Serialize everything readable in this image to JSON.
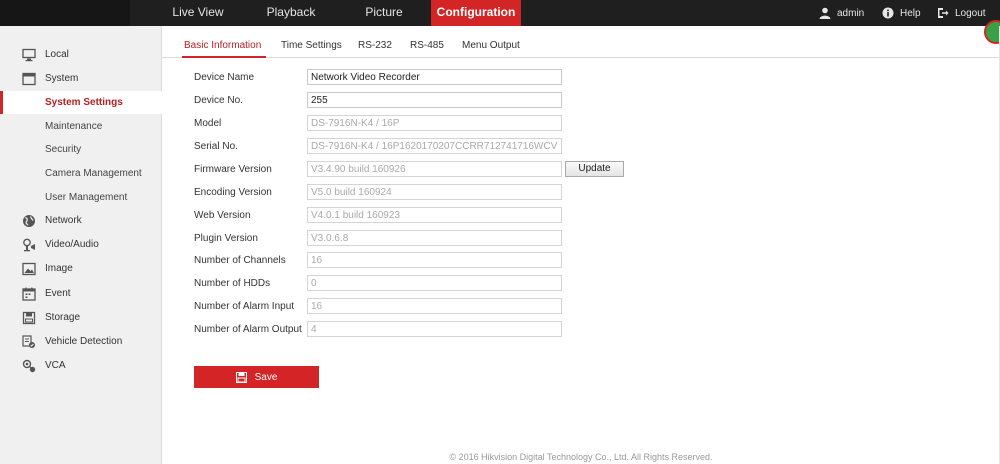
{
  "topnav": {
    "items": [
      {
        "label": "Live View",
        "active": false
      },
      {
        "label": "Playback",
        "active": false
      },
      {
        "label": "Picture",
        "active": false
      },
      {
        "label": "Configuration",
        "active": true
      }
    ],
    "user": "admin",
    "help": "Help",
    "logout": "Logout",
    "accent_color": "#d32426"
  },
  "sidebar": {
    "items": [
      {
        "label": "Local",
        "icon": "monitor-icon"
      },
      {
        "label": "System",
        "icon": "system-icon"
      },
      {
        "label": "System Settings",
        "sub": true,
        "active": true
      },
      {
        "label": "Maintenance",
        "sub": true
      },
      {
        "label": "Security",
        "sub": true
      },
      {
        "label": "Camera Management",
        "sub": true
      },
      {
        "label": "User Management",
        "sub": true
      },
      {
        "label": "Network",
        "icon": "globe-icon"
      },
      {
        "label": "Video/Audio",
        "icon": "video-audio-icon"
      },
      {
        "label": "Image",
        "icon": "image-icon"
      },
      {
        "label": "Event",
        "icon": "calendar-icon"
      },
      {
        "label": "Storage",
        "icon": "storage-icon"
      },
      {
        "label": "Vehicle Detection",
        "icon": "vehicle-icon"
      },
      {
        "label": "VCA",
        "icon": "vca-icon"
      }
    ]
  },
  "tabs": [
    {
      "label": "Basic Information",
      "active": true
    },
    {
      "label": "Time Settings",
      "active": false
    },
    {
      "label": "RS-232",
      "active": false
    },
    {
      "label": "RS-485",
      "active": false
    },
    {
      "label": "Menu Output",
      "active": false
    }
  ],
  "form": {
    "fields": [
      {
        "label": "Device Name",
        "value": "Network Video Recorder",
        "editable": true
      },
      {
        "label": "Device No.",
        "value": "255",
        "editable": true
      },
      {
        "label": "Model",
        "value": "DS-7916N-K4 / 16P",
        "editable": false
      },
      {
        "label": "Serial No.",
        "value": "DS-7916N-K4 / 16P1620170207CCRR712741716WCVU",
        "editable": false
      },
      {
        "label": "Firmware Version",
        "value": "V3.4.90 build 160926",
        "editable": false
      },
      {
        "label": "Encoding Version",
        "value": "V5.0 build 160924",
        "editable": false
      },
      {
        "label": "Web Version",
        "value": "V4.0.1 build 160923",
        "editable": false
      },
      {
        "label": "Plugin Version",
        "value": "V3.0.6.8",
        "editable": false
      },
      {
        "label": "Number of Channels",
        "value": "16",
        "editable": false
      },
      {
        "label": "Number of HDDs",
        "value": "0",
        "editable": false
      },
      {
        "label": "Number of Alarm Input",
        "value": "16",
        "editable": false
      },
      {
        "label": "Number of Alarm Output",
        "value": "4",
        "editable": false
      }
    ],
    "update_label": "Update",
    "save_label": "Save"
  },
  "footer": "© 2016 Hikvision Digital Technology Co., Ltd. All Rights Reserved."
}
